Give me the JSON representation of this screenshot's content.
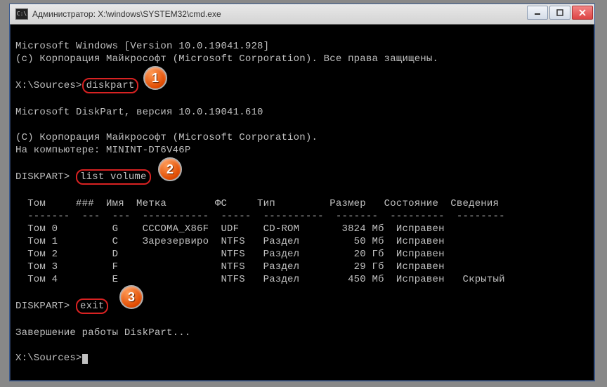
{
  "titlebar": {
    "icon_label": "C:\\",
    "text": "Администратор: X:\\windows\\SYSTEM32\\cmd.exe"
  },
  "lines": {
    "l1": "Microsoft Windows [Version 10.0.19041.928]",
    "l2": "(c) Корпорация Майкрософт (Microsoft Corporation). Все права защищены.",
    "l3_prompt": "X:\\Sources>",
    "l3_cmd": "diskpart",
    "l4": "Microsoft DiskPart, версия 10.0.19041.610",
    "l5": "(C) Корпорация Майкрософт (Microsoft Corporation).",
    "l6": "На компьютере: MININT-DT6V46P",
    "l7_prompt": "DISKPART> ",
    "l7_cmd": "list volume",
    "table_header": "  Том     ###  Имя  Метка        ФС     Тип         Размер   Состояние  Сведения",
    "table_divider": "  -------  ---  ---  -----------  -----  ----------  -------  ---------  --------",
    "row0": "  Том 0         G    CCCOMA_X86F  UDF    CD-ROM       3824 Мб  Исправен",
    "row1": "  Том 1         C    Зарезервиро  NTFS   Раздел         50 Мб  Исправен",
    "row2": "  Том 2         D                 NTFS   Раздел         20 Гб  Исправен",
    "row3": "  Том 3         F                 NTFS   Раздел         29 Гб  Исправен",
    "row4": "  Том 4         E                 NTFS   Раздел        450 Мб  Исправен   Скрытый",
    "l8_prompt": "DISKPART> ",
    "l8_cmd": "exit",
    "l9": "Завершение работы DiskPart...",
    "l10": "X:\\Sources>"
  },
  "badges": {
    "b1": "1",
    "b2": "2",
    "b3": "3"
  }
}
